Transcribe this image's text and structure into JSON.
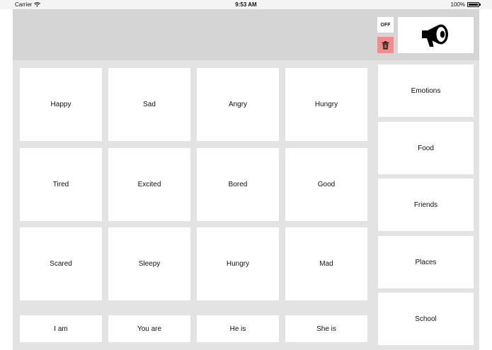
{
  "status_bar": {
    "carrier": "Carrier",
    "time": "9:53 AM",
    "battery": "100%"
  },
  "controls": {
    "toggle_label": "OFF",
    "trash_icon": "trash-icon",
    "speak_icon": "megaphone-icon",
    "trash_color": "#f28b8b"
  },
  "word_tiles": [
    "Happy",
    "Sad",
    "Angry",
    "Hungry",
    "Tired",
    "Excited",
    "Bored",
    "Good",
    "Scared",
    "Sleepy",
    "Hungry",
    "Mad"
  ],
  "starter_tiles": [
    "I am",
    "You are",
    "He is",
    "She is"
  ],
  "categories": [
    "Emotions",
    "Food",
    "Friends",
    "Places",
    "School"
  ]
}
